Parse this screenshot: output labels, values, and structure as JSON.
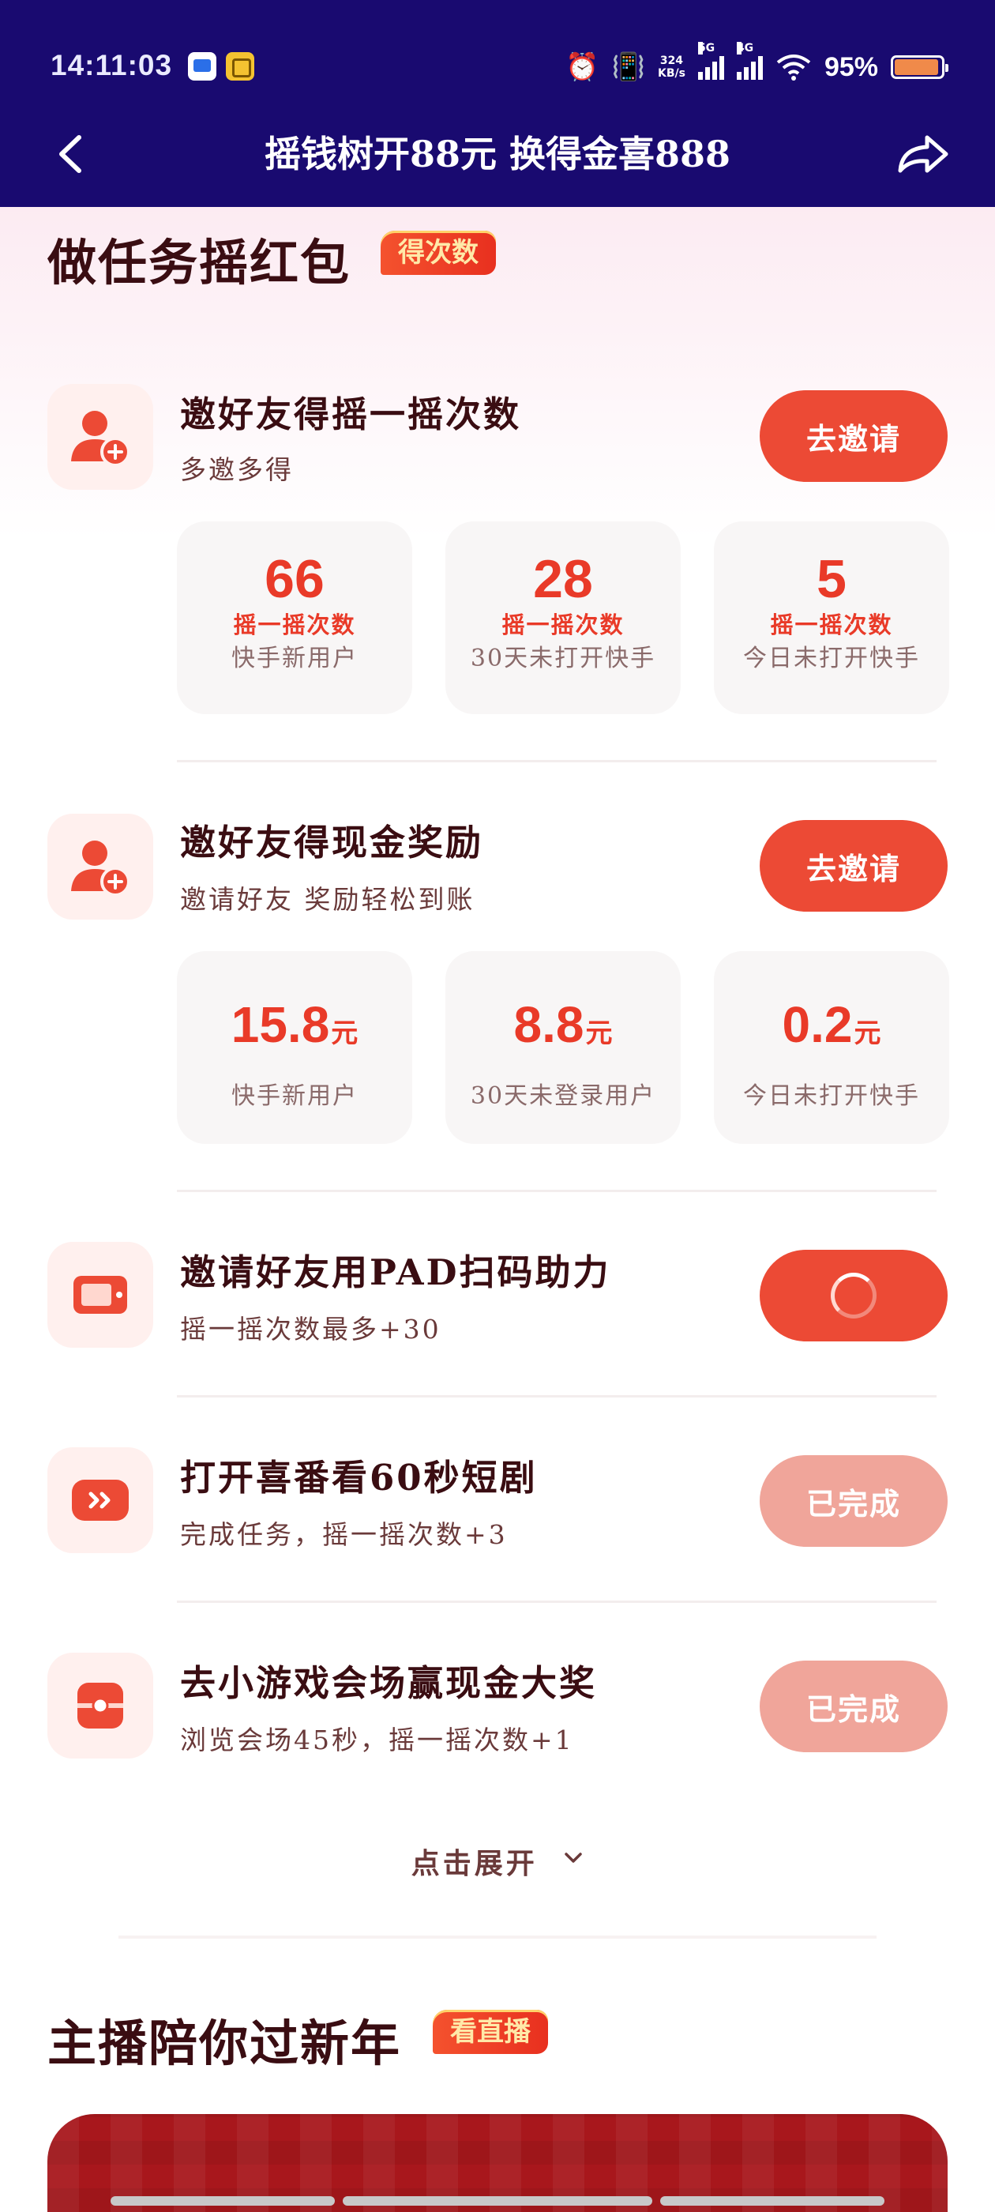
{
  "status_bar": {
    "time": "14:11:03",
    "net_speed": "324\nKB/s",
    "net_speed_top": "324",
    "net_speed_bottom": "KB/s",
    "sig1_label": "5G",
    "sig2_label": "4G",
    "battery_pct": "95%",
    "battery_level": 0.95
  },
  "header": {
    "title": "摇钱树开88元 换得金喜888"
  },
  "tasks_section": {
    "title": "做任务摇红包",
    "badge": "得次数",
    "tasks": [
      {
        "title": "邀好友得摇一摇次数",
        "subtitle": "多邀多得",
        "button": "去邀请",
        "stats": [
          {
            "value": "66",
            "label": "摇一摇次数",
            "desc": "快手新用户"
          },
          {
            "value": "28",
            "label": "摇一摇次数",
            "desc": "30天未打开快手"
          },
          {
            "value": "5",
            "label": "摇一摇次数",
            "desc": "今日未打开快手"
          }
        ]
      },
      {
        "title": "邀好友得现金奖励",
        "subtitle": "邀请好友 奖励轻松到账",
        "button": "去邀请",
        "stats": [
          {
            "value": "15.8",
            "unit": "元",
            "desc": "快手新用户"
          },
          {
            "value": "8.8",
            "unit": "元",
            "desc": "30天未登录用户"
          },
          {
            "value": "0.2",
            "unit": "元",
            "desc": "今日未打开快手"
          }
        ]
      },
      {
        "title": "邀请好友用PAD扫码助力",
        "subtitle": "摇一摇次数最多+30",
        "button_state": "loading"
      },
      {
        "title": "打开喜番看60秒短剧",
        "subtitle": "完成任务，摇一摇次数+3",
        "button": "已完成"
      },
      {
        "title": "去小游戏会场赢现金大奖",
        "subtitle": "浏览会场45秒，摇一摇次数+1",
        "button": "已完成"
      }
    ],
    "expand_label": "点击展开"
  },
  "live_section": {
    "title": "主播陪你过新年",
    "badge": "看直播"
  },
  "icons": {
    "back": "back-arrow-icon",
    "share": "share-icon",
    "invite": "add-user-icon",
    "pad": "tablet-icon",
    "drama": "play-icon",
    "game": "game-box-icon",
    "expand": "chevron-down-icon"
  },
  "colors": {
    "header_bg": "#190a70",
    "accent": "#ec4a35",
    "done_button": "#f0a59a",
    "stat_number": "#e93a28"
  }
}
